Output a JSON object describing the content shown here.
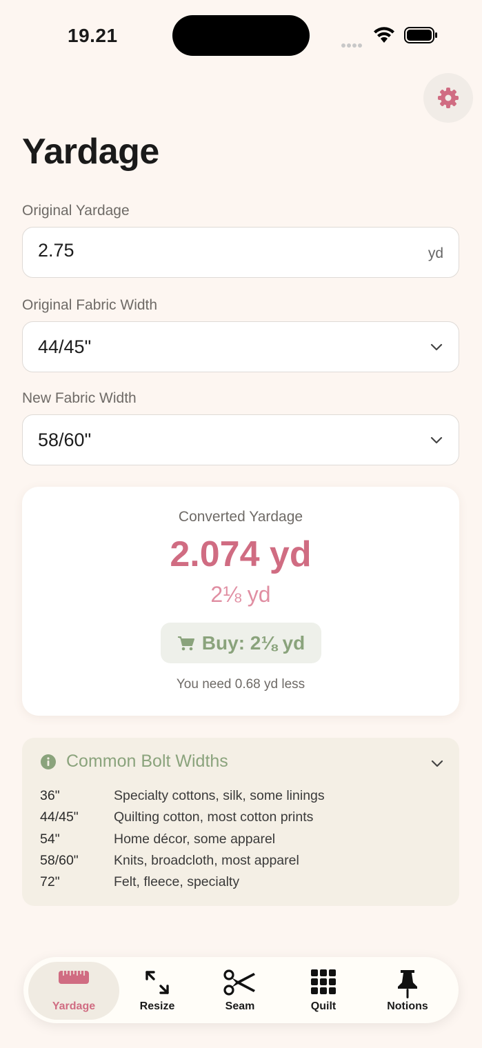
{
  "status_bar": {
    "time": "19.21"
  },
  "header": {
    "title": "Yardage",
    "settings_icon": "gear-icon"
  },
  "form": {
    "original_yardage": {
      "label": "Original Yardage",
      "value": "2.75",
      "unit": "yd"
    },
    "original_width": {
      "label": "Original Fabric Width",
      "value": "44/45\""
    },
    "new_width": {
      "label": "New Fabric Width",
      "value": "58/60\""
    }
  },
  "result": {
    "label": "Converted Yardage",
    "value": "2.074 yd",
    "fraction": "2⅛ yd",
    "buy": "Buy: 2⅛ yd",
    "note": "You need 0.68 yd less"
  },
  "bolt_widths": {
    "title": "Common Bolt Widths",
    "rows": [
      {
        "width": "36\"",
        "desc": "Specialty cottons, silk, some linings"
      },
      {
        "width": "44/45\"",
        "desc": "Quilting cotton, most cotton prints"
      },
      {
        "width": "54\"",
        "desc": "Home décor, some apparel"
      },
      {
        "width": "58/60\"",
        "desc": "Knits, broadcloth, most apparel"
      },
      {
        "width": "72\"",
        "desc": "Felt, fleece, specialty"
      }
    ]
  },
  "tabs": [
    {
      "label": "Yardage",
      "icon": "ruler-icon",
      "active": true
    },
    {
      "label": "Resize",
      "icon": "resize-arrows-icon",
      "active": false
    },
    {
      "label": "Seam",
      "icon": "scissors-icon",
      "active": false
    },
    {
      "label": "Quilt",
      "icon": "grid-icon",
      "active": false
    },
    {
      "label": "Notions",
      "icon": "pin-icon",
      "active": false
    }
  ],
  "colors": {
    "background": "#fdf6f1",
    "accent_pink": "#d06c82",
    "accent_green": "#8aa37c",
    "panel_beige": "#f4efe5"
  }
}
